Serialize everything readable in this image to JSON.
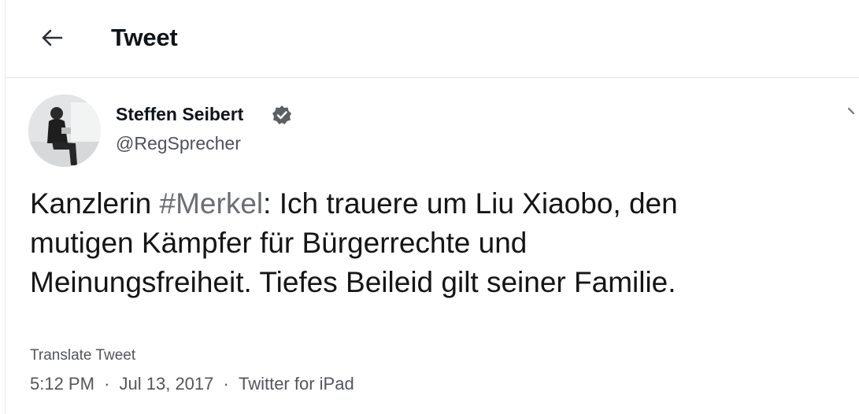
{
  "header": {
    "title": "Tweet",
    "back_icon": "arrow-left-icon"
  },
  "tweet": {
    "author": {
      "name": "Steffen Seibert",
      "handle": "@RegSprecher",
      "verified_icon": "verified-badge-icon"
    },
    "text": {
      "prefix": "Kanzlerin ",
      "hashtag": "#Merkel",
      "line1_rest": ": Ich trauere um Liu Xiaobo, den",
      "line2": "mutigen Kämpfer für Bürgerrechte und",
      "line3": "Meinungsfreiheit. Tiefes Beileid gilt seiner Familie."
    },
    "translate_label": "Translate Tweet",
    "meta": {
      "time": "5:12 PM",
      "separator": "·",
      "date": "Jul 13, 2017",
      "source": "Twitter for iPad"
    }
  },
  "colors": {
    "text": "#0f1419",
    "secondary": "#53565a",
    "hashtag": "#6b6e72",
    "divider": "#e3e5e6"
  }
}
